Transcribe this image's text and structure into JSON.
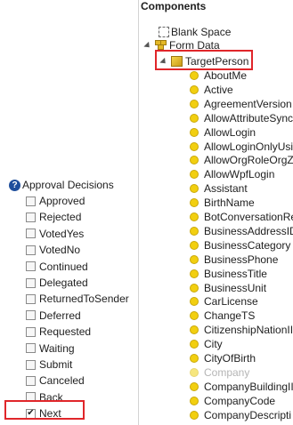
{
  "components": {
    "title": "Components",
    "blank_space": "Blank Space",
    "form_data": "Form Data",
    "target_person": "TargetPerson",
    "attributes": [
      {
        "label": "AboutMe"
      },
      {
        "label": "Active"
      },
      {
        "label": "AgreementVersion"
      },
      {
        "label": "AllowAttributeSync"
      },
      {
        "label": "AllowLogin"
      },
      {
        "label": "AllowLoginOnlyUsi"
      },
      {
        "label": "AllowOrgRoleOrgZ"
      },
      {
        "label": "AllowWpfLogin"
      },
      {
        "label": "Assistant"
      },
      {
        "label": "BirthName"
      },
      {
        "label": "BotConversationRe"
      },
      {
        "label": "BusinessAddressID"
      },
      {
        "label": "BusinessCategory"
      },
      {
        "label": "BusinessPhone"
      },
      {
        "label": "BusinessTitle"
      },
      {
        "label": "BusinessUnit"
      },
      {
        "label": "CarLicense"
      },
      {
        "label": "ChangeTS"
      },
      {
        "label": "CitizenshipNationII"
      },
      {
        "label": "City"
      },
      {
        "label": "CityOfBirth"
      },
      {
        "label": "Company",
        "dim": true
      },
      {
        "label": "CompanyBuildingII"
      },
      {
        "label": "CompanyCode"
      },
      {
        "label": "CompanyDescripti"
      }
    ]
  },
  "approval": {
    "title": "Approval Decisions",
    "decisions": [
      {
        "label": "Approved",
        "checked": false
      },
      {
        "label": "Rejected",
        "checked": false
      },
      {
        "label": "VotedYes",
        "checked": false
      },
      {
        "label": "VotedNo",
        "checked": false
      },
      {
        "label": "Continued",
        "checked": false
      },
      {
        "label": "Delegated",
        "checked": false
      },
      {
        "label": "ReturnedToSender",
        "checked": false
      },
      {
        "label": "Deferred",
        "checked": false
      },
      {
        "label": "Requested",
        "checked": false
      },
      {
        "label": "Waiting",
        "checked": false
      },
      {
        "label": "Submit",
        "checked": false
      },
      {
        "label": "Canceled",
        "checked": false
      },
      {
        "label": "Back",
        "checked": false
      },
      {
        "label": "Next",
        "checked": true
      }
    ]
  },
  "colors": {
    "highlight": "#e0262a",
    "attribute_dot": "#f2cf10"
  }
}
